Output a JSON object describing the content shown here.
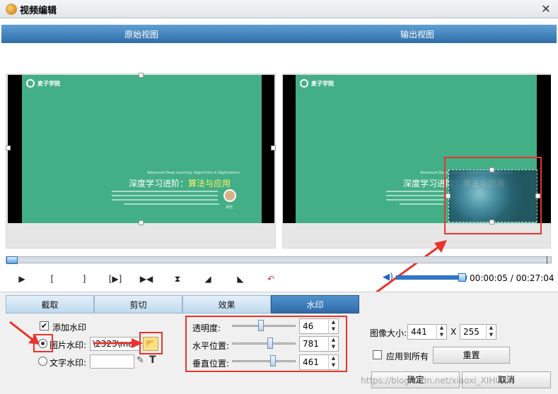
{
  "window": {
    "title": "视频编辑",
    "close": "✕"
  },
  "views": {
    "original_label": "原始视图",
    "output_label": "输出视图"
  },
  "slide": {
    "logo_text": "麦子学院",
    "subtitle_en": "Advanced Deep Learning: Algorithms & Applications",
    "title_main": "深度学习进阶：",
    "title_highlight": "算法与应用",
    "presenter": "郑光"
  },
  "controls": {
    "time": "00:00:05 / 00:27:04"
  },
  "tabs": [
    "截取",
    "剪切",
    "效果",
    "水印"
  ],
  "active_tab": 3,
  "watermark_panel": {
    "add_watermark": "添加水印",
    "add_checked": true,
    "image_wm_label": "图片水印:",
    "image_wm_path": "\\2323\\mai",
    "text_wm_label": "文字水印:",
    "text_wm_value": "",
    "opacity_label": "透明度:",
    "opacity_value": "46",
    "hpos_label": "水平位置:",
    "hpos_value": "781",
    "vpos_label": "垂直位置:",
    "vpos_value": "461",
    "size_label": "图像大小:",
    "size_w": "441",
    "size_x": "X",
    "size_h": "255",
    "apply_all_label": "应用到所有",
    "reset_label": "重置"
  },
  "buttons": {
    "ok": "确定",
    "cancel": "取消"
  },
  "site_watermark": "https://blog.csdn.net/xiaoxi_XIHUA"
}
